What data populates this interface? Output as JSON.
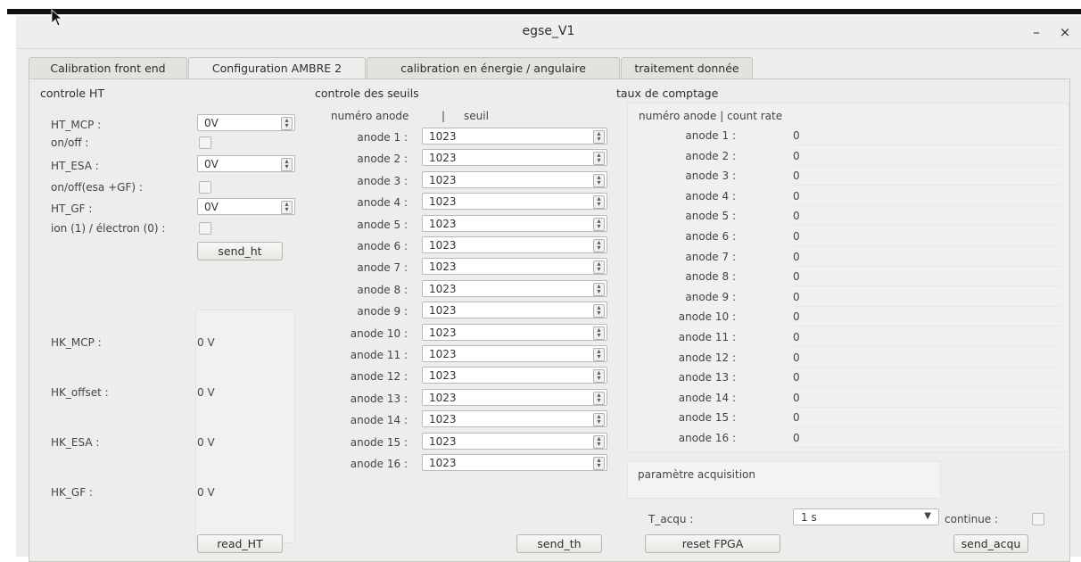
{
  "window": {
    "title": "egse_V1",
    "minimize": "–",
    "close": "×"
  },
  "tabs": [
    "Calibration front end",
    "Configuration AMBRE 2",
    "calibration en énergie / angulaire",
    "traitement donnée"
  ],
  "ht": {
    "section": "controle HT",
    "hv_rows": [
      {
        "label": "HT_MCP :",
        "value": "0V"
      },
      {
        "label": "HT_ESA :",
        "value": "0V"
      },
      {
        "label": "HT_GF :",
        "value": "0V"
      }
    ],
    "checkbox_rows": [
      {
        "label": "on/off :"
      },
      {
        "label": "on/off(esa +GF) :"
      },
      {
        "label": "ion (1) / électron (0) :"
      }
    ],
    "send_button": "send_ht",
    "hk": [
      {
        "label": "HK_MCP :",
        "value": "0 V"
      },
      {
        "label": "HK_offset :",
        "value": "0 V"
      },
      {
        "label": "HK_ESA :",
        "value": "0 V"
      },
      {
        "label": "HK_GF :",
        "value": "0 V"
      }
    ],
    "read_button": "read_HT"
  },
  "seuils": {
    "section": "controle des seuils",
    "header_anode": "numéro anode",
    "header_sep": "|",
    "header_seuil": "seuil",
    "rows": [
      {
        "label": "anode 1 :",
        "value": "1023"
      },
      {
        "label": "anode 2 :",
        "value": "1023"
      },
      {
        "label": "anode 3 :",
        "value": "1023"
      },
      {
        "label": "anode 4 :",
        "value": "1023"
      },
      {
        "label": "anode 5 :",
        "value": "1023"
      },
      {
        "label": "anode 6 :",
        "value": "1023"
      },
      {
        "label": "anode 7 :",
        "value": "1023"
      },
      {
        "label": "anode 8 :",
        "value": "1023"
      },
      {
        "label": "anode 9 :",
        "value": "1023"
      },
      {
        "label": "anode 10 :",
        "value": "1023"
      },
      {
        "label": "anode 11 :",
        "value": "1023"
      },
      {
        "label": "anode 12 :",
        "value": "1023"
      },
      {
        "label": "anode 13 :",
        "value": "1023"
      },
      {
        "label": "anode 14 :",
        "value": "1023"
      },
      {
        "label": "anode 15 :",
        "value": "1023"
      },
      {
        "label": "anode 16 :",
        "value": "1023"
      }
    ],
    "send_button": "send_th"
  },
  "comptage": {
    "section": "taux de comptage",
    "header": "numéro anode  |  count rate",
    "rows": [
      {
        "label": "anode 1 :",
        "value": "0"
      },
      {
        "label": "anode 2 :",
        "value": "0"
      },
      {
        "label": "anode 3 :",
        "value": "0"
      },
      {
        "label": "anode 4 :",
        "value": "0"
      },
      {
        "label": "anode 5 :",
        "value": "0"
      },
      {
        "label": "anode 6 :",
        "value": "0"
      },
      {
        "label": "anode 7 :",
        "value": "0"
      },
      {
        "label": "anode 8 :",
        "value": "0"
      },
      {
        "label": "anode 9 :",
        "value": "0"
      },
      {
        "label": "anode 10 :",
        "value": "0"
      },
      {
        "label": "anode 11 :",
        "value": "0"
      },
      {
        "label": "anode 12 :",
        "value": "0"
      },
      {
        "label": "anode 13 :",
        "value": "0"
      },
      {
        "label": "anode 14 :",
        "value": "0"
      },
      {
        "label": "anode 15 :",
        "value": "0"
      },
      {
        "label": "anode 16 :",
        "value": "0"
      }
    ],
    "params_label": "paramètre acquisition",
    "tacqu_label": "T_acqu :",
    "tacqu_value": "1 s",
    "continue_label": "continue :",
    "reset_button": "reset FPGA",
    "send_button": "send_acqu"
  }
}
